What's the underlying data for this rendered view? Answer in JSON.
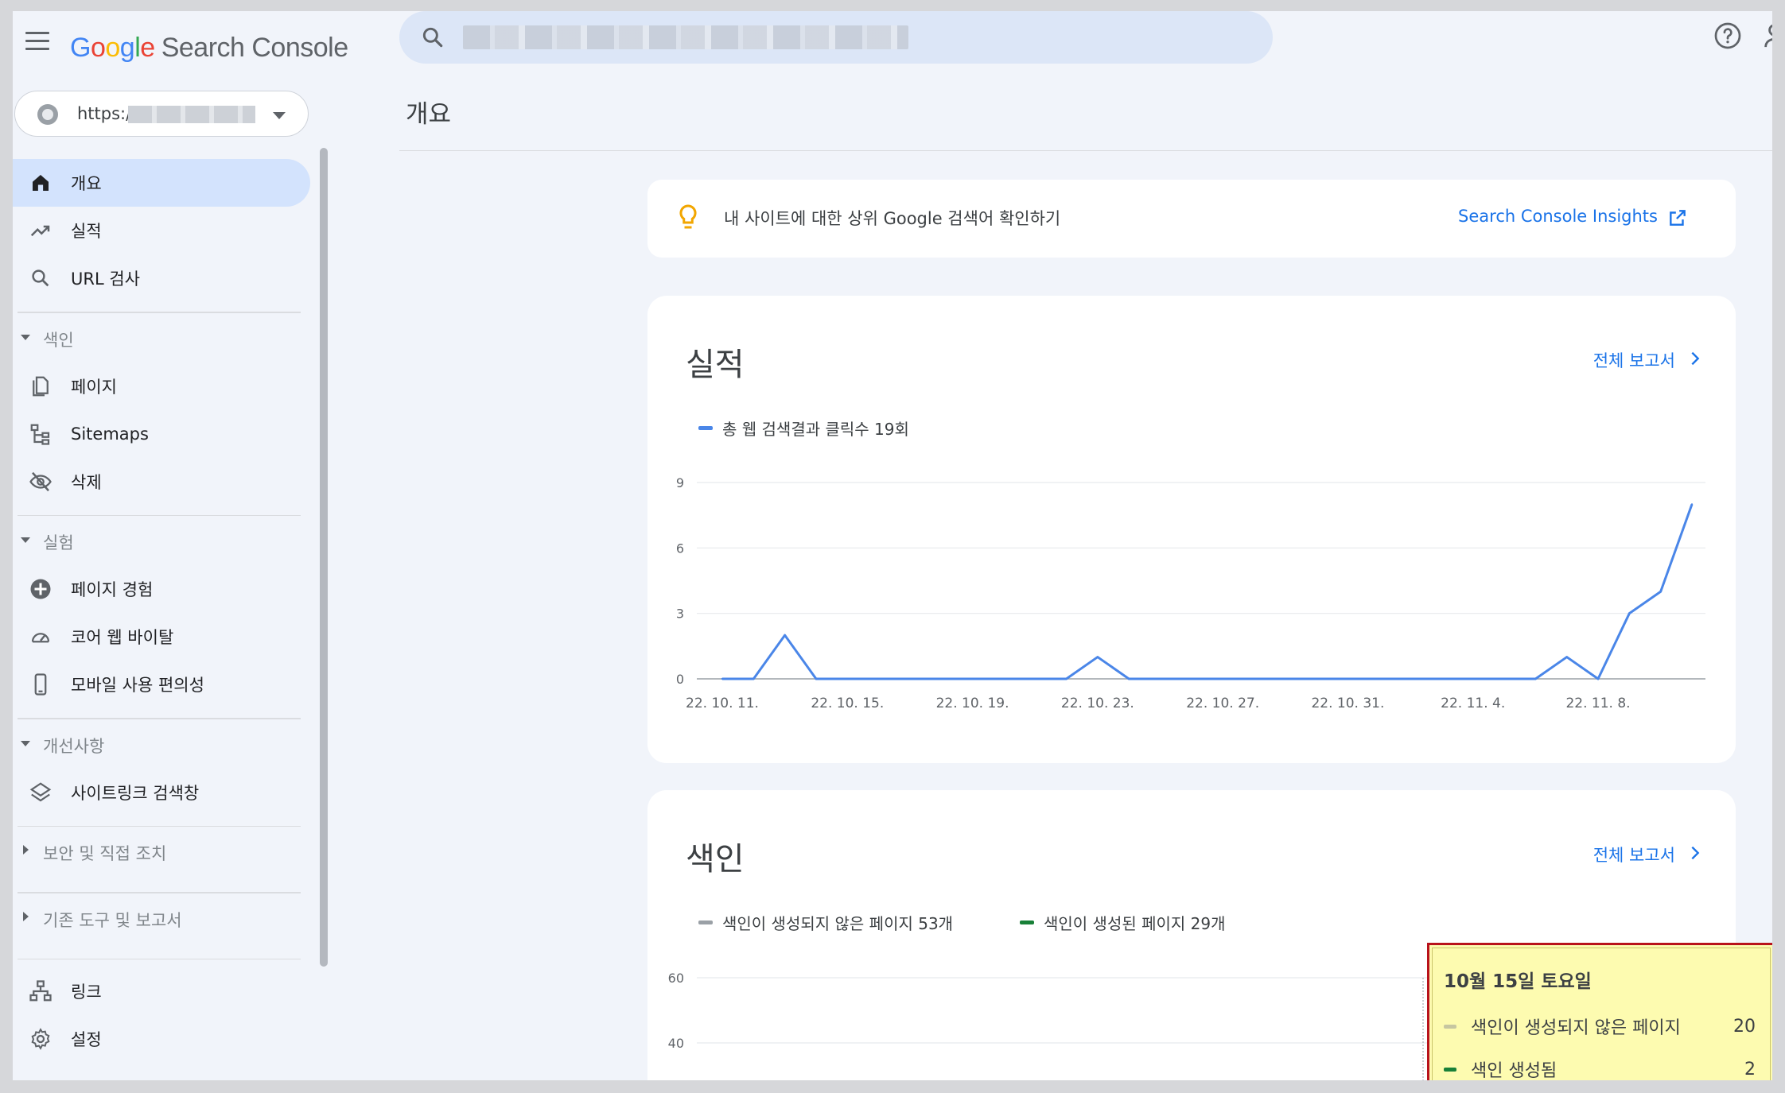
{
  "header": {
    "logo_google": "Google",
    "logo_product": "Search Console"
  },
  "property": {
    "url_prefix": "https:/"
  },
  "nav": {
    "overview": "개요",
    "performance": "실적",
    "url_inspection": "URL 검사",
    "section_index": "색인",
    "pages": "페이지",
    "sitemaps": "Sitemaps",
    "removals": "삭제",
    "section_experience": "실험",
    "page_experience": "페이지 경험",
    "core_web_vitals": "코어 웹 바이탈",
    "mobile_usability": "모바일 사용 편의성",
    "section_enhancements": "개선사항",
    "sitelinks_searchbox": "사이트링크 검색창",
    "section_security": "보안 및 직접 조치",
    "section_legacy": "기존 도구 및 보고서",
    "links": "링크",
    "settings": "설정"
  },
  "main": {
    "page_title": "개요",
    "insight_text": "내 사이트에 대한 상위 Google 검색어 확인하기",
    "insight_link": "Search Console Insights",
    "perf_title": "실적",
    "perf_full_report": "전체 보고서",
    "perf_legend": "총 웹 검색결과 클릭수 19회",
    "index_title": "색인",
    "index_full_report": "전체 보고서",
    "index_legend_not_indexed": "색인이 생성되지 않은 페이지 53개",
    "index_legend_indexed": "색인이 생성된 페이지 29개"
  },
  "tooltip": {
    "date": "10월 15일 토요일",
    "row1_label": "색인이 생성되지 않은 페이지",
    "row1_value": "20",
    "row2_label": "색인 생성됨",
    "row2_value": "2"
  },
  "colors": {
    "clicks": "#4a86e8",
    "not_indexed": "#9aa0a6",
    "indexed": "#188038",
    "accent": "#1a73e8"
  },
  "chart_data": [
    {
      "type": "line",
      "ylim": [
        0,
        9
      ],
      "yticks": [
        0,
        3,
        6,
        9
      ],
      "xtick_labels": [
        "22. 10. 11.",
        "22. 10. 15.",
        "22. 10. 19.",
        "22. 10. 23.",
        "22. 10. 27.",
        "22. 10. 31.",
        "22. 11. 4.",
        "22. 11. 8."
      ],
      "series": [
        {
          "name": "총 웹 검색결과 클릭수 19회",
          "x": [
            "2022-10-11",
            "2022-10-12",
            "2022-10-13",
            "2022-10-14",
            "2022-10-15",
            "2022-10-16",
            "2022-10-17",
            "2022-10-18",
            "2022-10-19",
            "2022-10-20",
            "2022-10-21",
            "2022-10-22",
            "2022-10-23",
            "2022-10-24",
            "2022-10-25",
            "2022-10-26",
            "2022-10-27",
            "2022-10-28",
            "2022-10-29",
            "2022-10-30",
            "2022-10-31",
            "2022-11-01",
            "2022-11-02",
            "2022-11-03",
            "2022-11-04",
            "2022-11-05",
            "2022-11-06",
            "2022-11-07",
            "2022-11-08",
            "2022-11-09",
            "2022-11-10",
            "2022-11-11"
          ],
          "values": [
            0,
            0,
            2,
            0,
            0,
            0,
            0,
            0,
            0,
            0,
            0,
            0,
            1,
            0,
            0,
            0,
            0,
            0,
            0,
            0,
            0,
            0,
            0,
            0,
            0,
            0,
            0,
            1,
            0,
            3,
            4,
            8
          ]
        }
      ]
    },
    {
      "type": "line",
      "yticks": [
        40,
        60
      ],
      "series": [
        {
          "name": "색인이 생성되지 않은 페이지 53개"
        },
        {
          "name": "색인이 생성된 페이지 29개"
        }
      ]
    }
  ]
}
